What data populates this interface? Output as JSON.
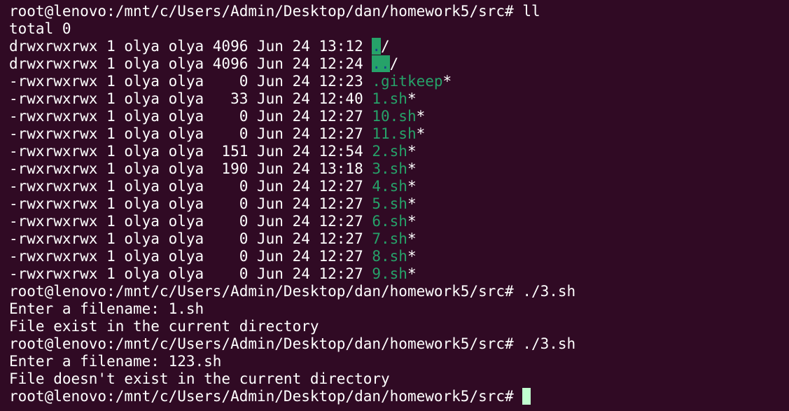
{
  "colors": {
    "background": "#300a24",
    "text": "#ffffff",
    "executable_green": "#26a269",
    "dir_highlight_bg": "#26a269",
    "dir_highlight_fg": "#12488b",
    "cursor": "#c1ffd0"
  },
  "prompt": "root@lenovo:/mnt/c/Users/Admin/Desktop/dan/homework5/src# ",
  "cmd1": "ll",
  "total": "total 0",
  "entries": [
    {
      "meta": "drwxrwxrwx 1 olya olya 4096 Jun 24 13:12 ",
      "name": ".",
      "suffix": "/"
    },
    {
      "meta": "drwxrwxrwx 1 olya olya 4096 Jun 24 12:24 ",
      "name": "..",
      "suffix": "/"
    },
    {
      "meta": "-rwxrwxrwx 1 olya olya    0 Jun 24 12:23 ",
      "name": ".gitkeep",
      "suffix": "*"
    },
    {
      "meta": "-rwxrwxrwx 1 olya olya   33 Jun 24 12:40 ",
      "name": "1.sh",
      "suffix": "*"
    },
    {
      "meta": "-rwxrwxrwx 1 olya olya    0 Jun 24 12:27 ",
      "name": "10.sh",
      "suffix": "*"
    },
    {
      "meta": "-rwxrwxrwx 1 olya olya    0 Jun 24 12:27 ",
      "name": "11.sh",
      "suffix": "*"
    },
    {
      "meta": "-rwxrwxrwx 1 olya olya  151 Jun 24 12:54 ",
      "name": "2.sh",
      "suffix": "*"
    },
    {
      "meta": "-rwxrwxrwx 1 olya olya  190 Jun 24 13:18 ",
      "name": "3.sh",
      "suffix": "*"
    },
    {
      "meta": "-rwxrwxrwx 1 olya olya    0 Jun 24 12:27 ",
      "name": "4.sh",
      "suffix": "*"
    },
    {
      "meta": "-rwxrwxrwx 1 olya olya    0 Jun 24 12:27 ",
      "name": "5.sh",
      "suffix": "*"
    },
    {
      "meta": "-rwxrwxrwx 1 olya olya    0 Jun 24 12:27 ",
      "name": "6.sh",
      "suffix": "*"
    },
    {
      "meta": "-rwxrwxrwx 1 olya olya    0 Jun 24 12:27 ",
      "name": "7.sh",
      "suffix": "*"
    },
    {
      "meta": "-rwxrwxrwx 1 olya olya    0 Jun 24 12:27 ",
      "name": "8.sh",
      "suffix": "*"
    },
    {
      "meta": "-rwxrwxrwx 1 olya olya    0 Jun 24 12:27 ",
      "name": "9.sh",
      "suffix": "*"
    }
  ],
  "run1": {
    "cmd": "./3.sh",
    "input_line": "Enter a filename: 1.sh",
    "result": "File exist in the current directory"
  },
  "run2": {
    "cmd": "./3.sh",
    "input_line": "Enter a filename: 123.sh",
    "result": "File doesn't exist in the current directory"
  }
}
